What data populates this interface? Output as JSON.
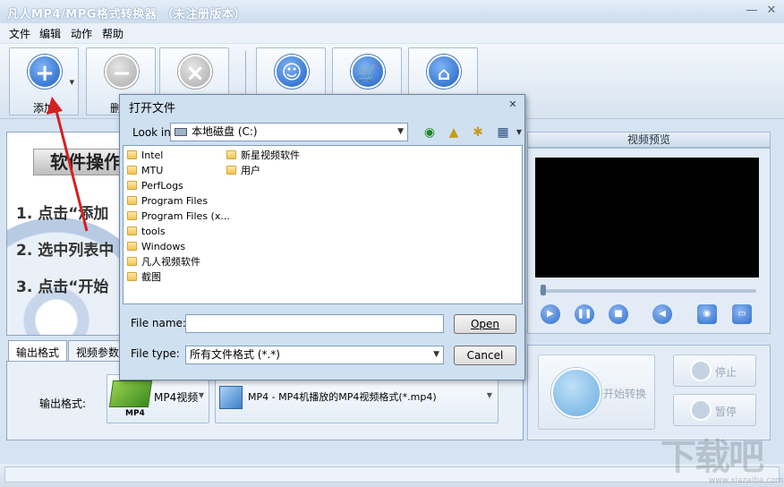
{
  "window": {
    "title": "凡人MP4/MPG格式转换器 （未注册版本）",
    "minimize_glyph": "—",
    "close_glyph": "✕"
  },
  "menu": [
    "文件",
    "编辑",
    "动作",
    "帮助"
  ],
  "toolbar": {
    "add": {
      "label": "添加",
      "icon": "plus-icon"
    },
    "delete": {
      "label": "删除",
      "icon": "minus-icon"
    },
    "clear": {
      "label": "",
      "icon": "x-icon"
    },
    "smile": {
      "icon": "smiley-icon"
    },
    "shop": {
      "icon": "cart-icon"
    },
    "home": {
      "icon": "home-icon"
    },
    "dropdown_glyph": "▼"
  },
  "instructions": {
    "heading": "软件操作",
    "steps": [
      "1. 点击“添加",
      "2. 选中列表中",
      "3. 点击“开始"
    ]
  },
  "bottom_tabs": [
    "输出格式",
    "视频参数"
  ],
  "output": {
    "label": "输出格式:",
    "format_short": "MP4视频",
    "format_badge": "MP4",
    "format_long": "MP4 - MP4机播放的MP4视频格式(*.mp4)"
  },
  "preview": {
    "title": "视频预览"
  },
  "convert": {
    "start": "开始转换",
    "stop": "停止",
    "pause": "暂停"
  },
  "dialog": {
    "title": "打开文件",
    "close_glyph": "✕",
    "look_in_label": "Look in:",
    "look_in_value": "本地磁盘 (C:)",
    "files_col1": [
      "Intel",
      "MTU",
      "PerfLogs",
      "Program Files",
      "Program Files (x...",
      "tools",
      "Windows",
      "凡人视频软件",
      "截图"
    ],
    "files_col2": [
      "新星视频软件",
      "用户"
    ],
    "file_name_label": "File name:",
    "file_name_value": "",
    "file_type_label": "File type:",
    "file_type_value": "所有文件格式 (*.*)",
    "open_button": "Open",
    "cancel_button": "Cancel"
  },
  "watermark": {
    "text": "下载吧",
    "url": "www.xiazaiba.com"
  },
  "colors": {
    "accent": "#2c6fd0",
    "arrow": "#d42020",
    "titlebar": "#d0deee"
  }
}
